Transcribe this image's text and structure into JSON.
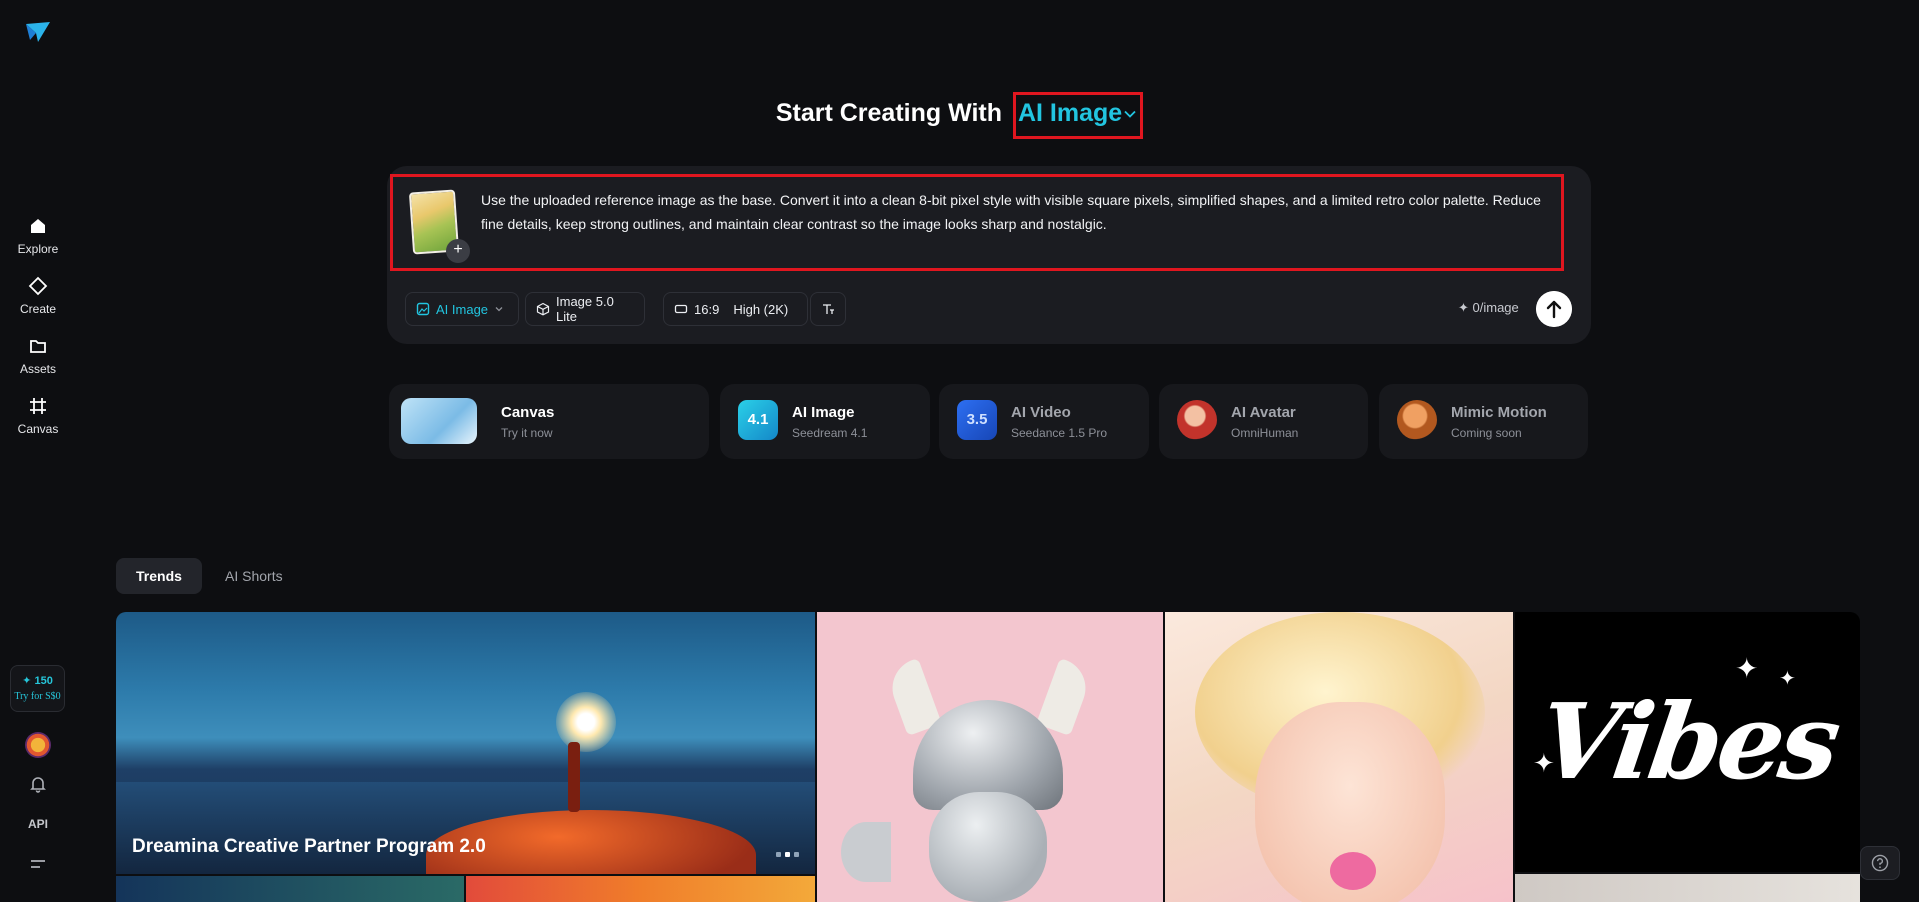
{
  "sidebar": {
    "items": [
      {
        "label": "Explore",
        "icon": "home-icon"
      },
      {
        "label": "Create",
        "icon": "diamond-icon"
      },
      {
        "label": "Assets",
        "icon": "folder-icon"
      },
      {
        "label": "Canvas",
        "icon": "frame-icon"
      }
    ],
    "credits": "150",
    "try_label": "Try for S$0",
    "api_label": "API"
  },
  "heading": {
    "prefix": "Start Creating With",
    "mode": "AI Image"
  },
  "prompt": {
    "text": "Use the uploaded reference image as the base. Convert it into a clean 8-bit pixel style with visible square pixels, simplified shapes, and a limited retro color palette. Reduce fine details, keep strong outlines, and maintain clear contrast so the image looks sharp and nostalgic.",
    "add_symbol": "+"
  },
  "toolbar": {
    "mode": "AI Image",
    "model": "Image 5.0 Lite",
    "ratio": "16:9",
    "quality": "High (2K)",
    "cost": "0/image"
  },
  "cards": [
    {
      "title": "Canvas",
      "subtitle": "Try it now"
    },
    {
      "title": "AI Image",
      "subtitle": "Seedream 4.1",
      "badge": "4.1"
    },
    {
      "title": "AI Video",
      "subtitle": "Seedance 1.5 Pro",
      "badge": "3.5"
    },
    {
      "title": "AI Avatar",
      "subtitle": "OmniHuman"
    },
    {
      "title": "Mimic Motion",
      "subtitle": "Coming soon"
    }
  ],
  "tabs": [
    {
      "label": "Trends",
      "active": true
    },
    {
      "label": "AI Shorts",
      "active": false
    }
  ],
  "gallery": {
    "featured_caption": "Dreamina Creative Partner Program 2.0",
    "vibes_text": "Vibes"
  },
  "colors": {
    "accent": "#22c5e0",
    "highlight_border": "#e0161f",
    "background": "#0d0e11",
    "panel": "#1b1c21"
  }
}
